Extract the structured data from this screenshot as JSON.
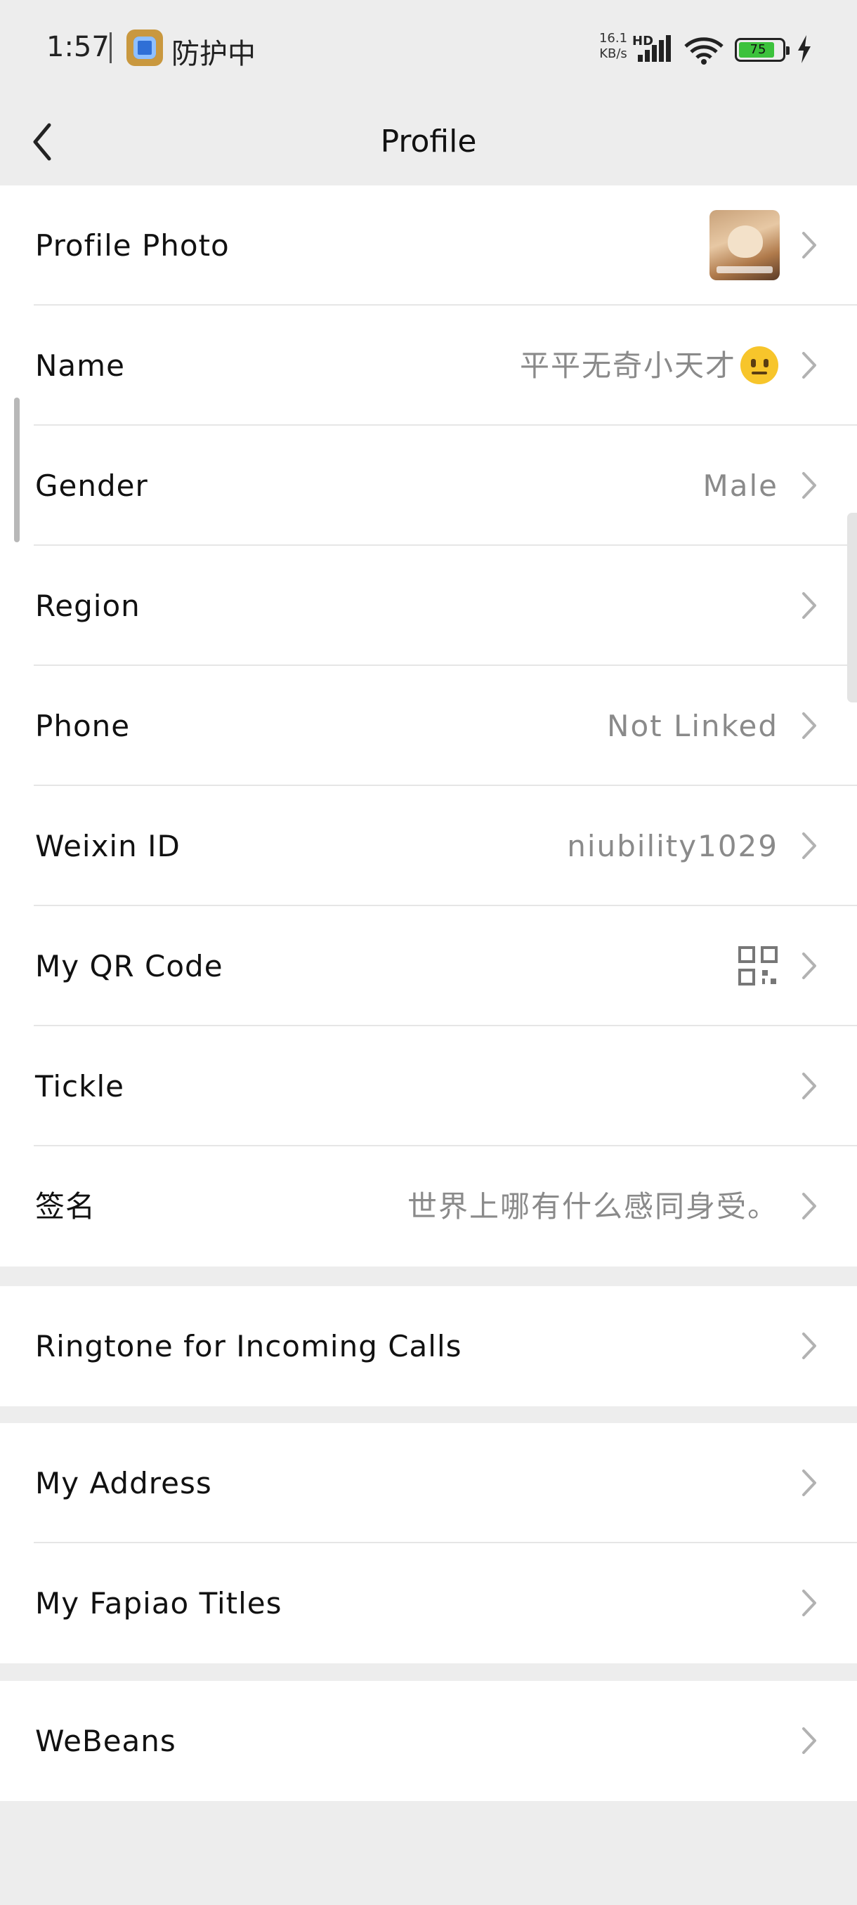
{
  "status_bar": {
    "time": "1:57",
    "app_status": "防护中",
    "net_speed_value": "16.1",
    "net_speed_unit": "KB/s",
    "network_type": "HD",
    "battery_level": "75",
    "icons": [
      "shield-app-icon",
      "signal-icon",
      "wifi-icon",
      "battery-icon",
      "charging-icon"
    ]
  },
  "nav": {
    "title": "Profile",
    "back_icon": "chevron-left-icon"
  },
  "groups": [
    {
      "rows": [
        {
          "label": "Profile Photo",
          "value": "",
          "type": "photo"
        },
        {
          "label": "Name",
          "value": "平平无奇小天才",
          "type": "emoji"
        },
        {
          "label": "Gender",
          "value": "Male",
          "type": "text"
        },
        {
          "label": "Region",
          "value": "",
          "type": "text"
        },
        {
          "label": "Phone",
          "value": "Not Linked",
          "type": "text"
        },
        {
          "label": "Weixin ID",
          "value": "niubility1029",
          "type": "text"
        },
        {
          "label": "My QR Code",
          "value": "",
          "type": "qr"
        },
        {
          "label": "Tickle",
          "value": "",
          "type": "text"
        },
        {
          "label": "签名",
          "value": "世界上哪有什么感同身受。",
          "type": "text"
        }
      ]
    },
    {
      "rows": [
        {
          "label": "Ringtone for Incoming Calls",
          "value": "",
          "type": "text"
        }
      ]
    },
    {
      "rows": [
        {
          "label": "My Address",
          "value": "",
          "type": "text"
        },
        {
          "label": "My Fapiao Titles",
          "value": "",
          "type": "text"
        }
      ]
    },
    {
      "rows": [
        {
          "label": "WeBeans",
          "value": "",
          "type": "text"
        }
      ]
    }
  ],
  "colors": {
    "background": "#ededed",
    "row_background": "#ffffff",
    "secondary_text": "#8a8a8a",
    "battery_fill": "#3cc23c"
  }
}
